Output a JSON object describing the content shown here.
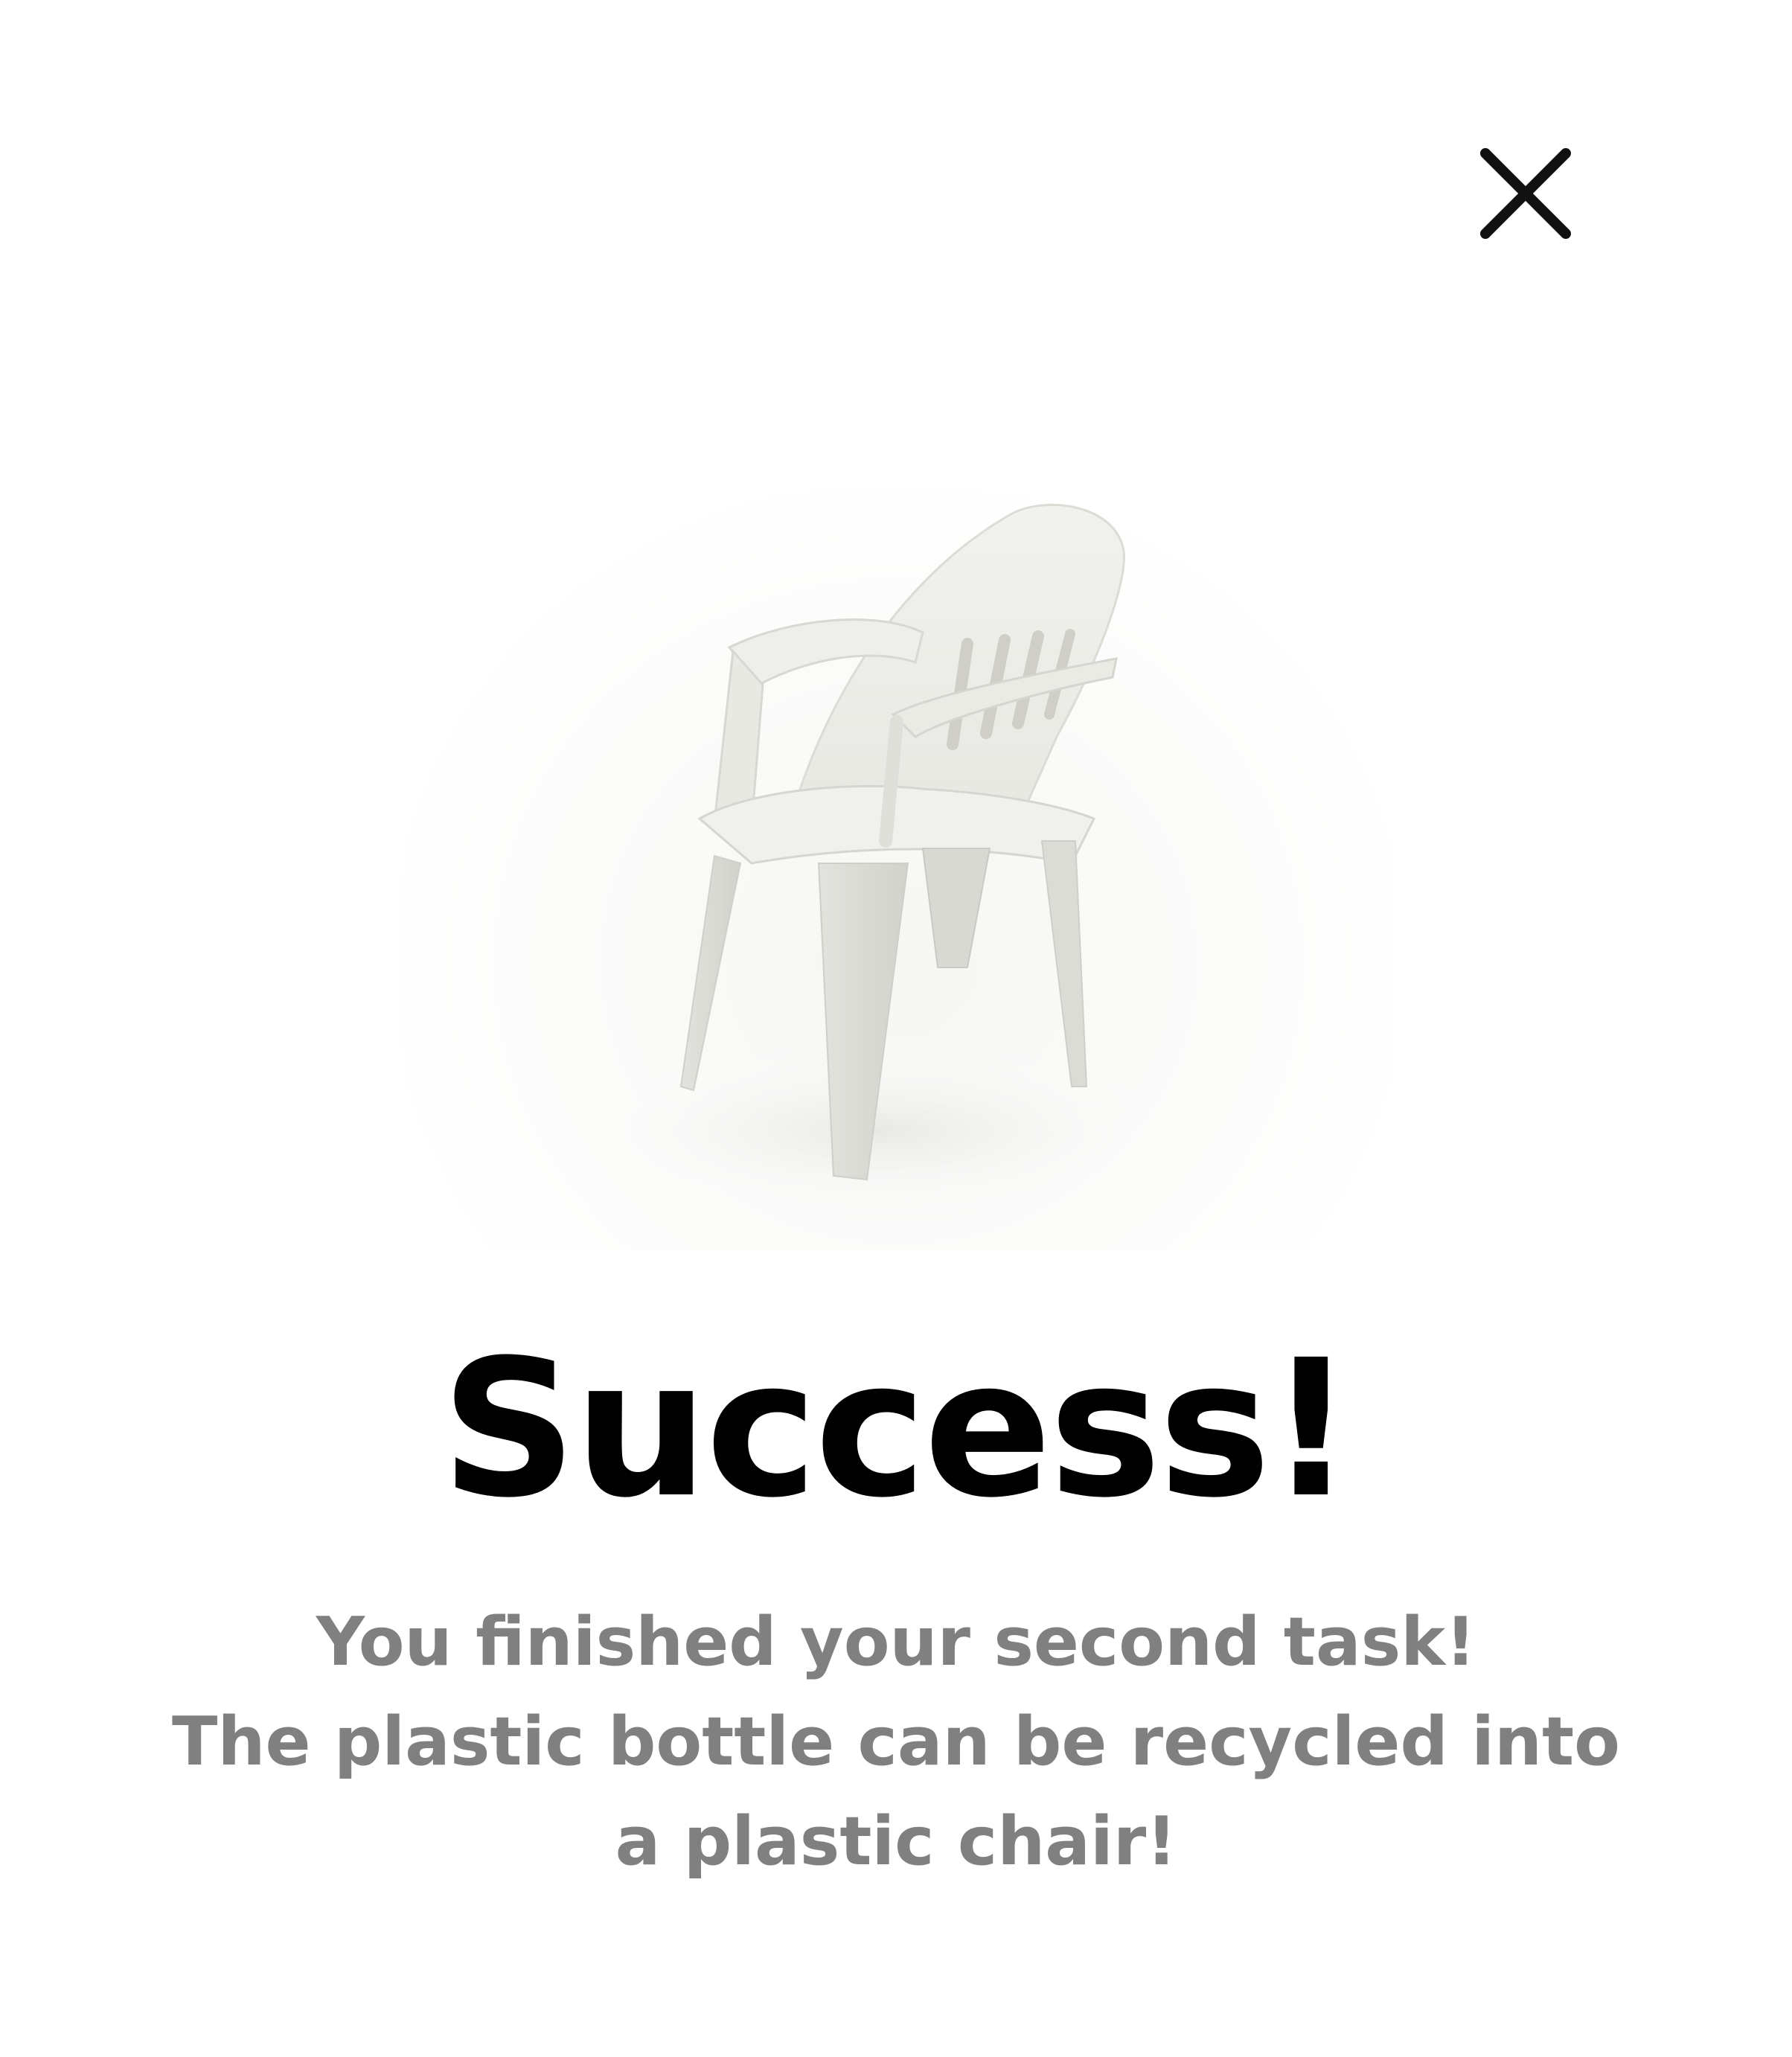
{
  "dialog": {
    "close_icon": "close-icon",
    "image_subject": "plastic-chair",
    "title": "Success!",
    "message_lines": [
      "You finished your second task!",
      "The plastic bottle can be recycled into a plastic chair!"
    ]
  },
  "colors": {
    "background": "#ffffff",
    "title": "#000000",
    "message": "#808080",
    "close_icon": "#111111"
  }
}
